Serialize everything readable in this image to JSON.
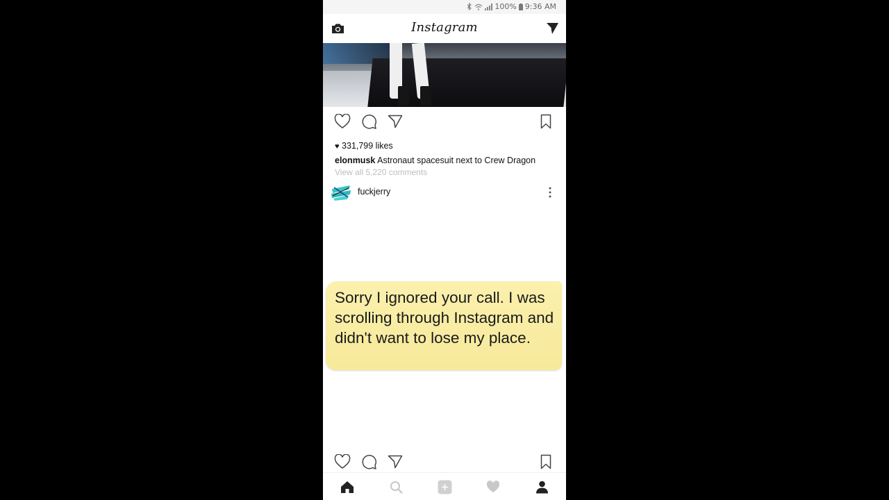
{
  "status_bar": {
    "battery": "100%",
    "time": "9:36 AM"
  },
  "app": {
    "title": "Instagram"
  },
  "post1": {
    "likes_text": "331,799 likes",
    "author": "elonmusk",
    "caption": "Astronaut spacesuit next to Crew Dragon",
    "view_comments": "View all 5,220 comments"
  },
  "post2": {
    "author": "fuckjerry",
    "meme_text": "Sorry I ignored your call. I was scrolling through Instagram and didn't want to lose my place."
  },
  "icons": {
    "camera": "camera-icon",
    "direct": "paper-plane-icon",
    "like": "heart-icon",
    "comment": "comment-icon",
    "share": "share-icon",
    "save": "bookmark-icon",
    "more": "more-vertical-icon",
    "nav": [
      "home-icon",
      "search-icon",
      "add-icon",
      "activity-icon",
      "profile-icon"
    ]
  },
  "colors": {
    "meme_bg": "#f7e99a",
    "text": "#111111",
    "muted": "#bdbdbd"
  }
}
